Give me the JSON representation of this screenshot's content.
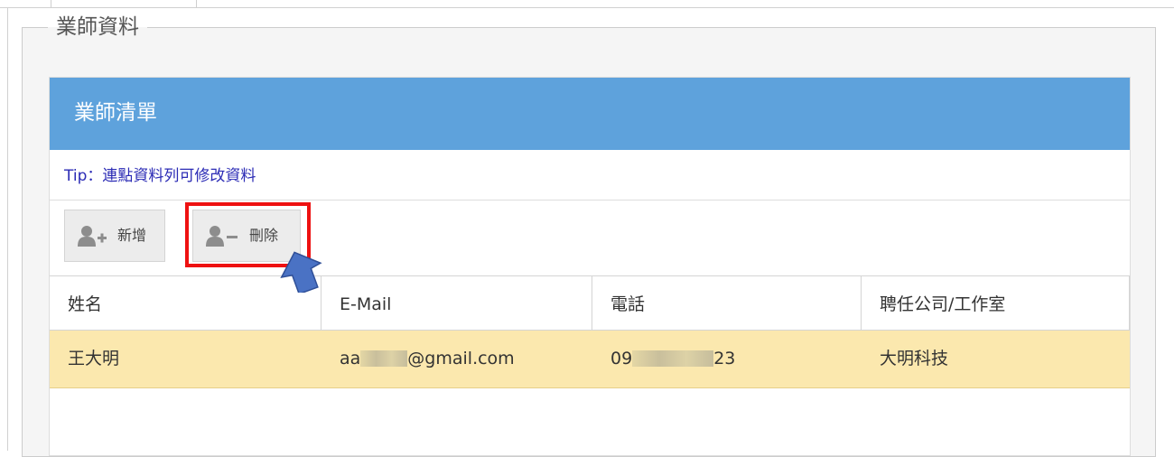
{
  "section": {
    "legend": "業師資料"
  },
  "panel": {
    "title": "業師清單",
    "tip": "Tip：連點資料列可修改資料"
  },
  "toolbar": {
    "add_label": "新增",
    "delete_label": "刪除",
    "add_icon": "user-plus-icon",
    "delete_icon": "user-minus-icon"
  },
  "table": {
    "columns": [
      "姓名",
      "E-Mail",
      "電話",
      "聘任公司/工作室"
    ],
    "rows": [
      {
        "name": "王大明",
        "email_prefix": "aa",
        "email_suffix": "@gmail.com",
        "phone_prefix": "09",
        "phone_suffix": "23",
        "company": "大明科技"
      }
    ],
    "selected_row_color": "#fbe8ae"
  },
  "colors": {
    "header_bg": "#5ea2dc",
    "highlight": "#ee1111",
    "pointer": "#4a72c4",
    "tip_text": "#2b2bb5"
  }
}
